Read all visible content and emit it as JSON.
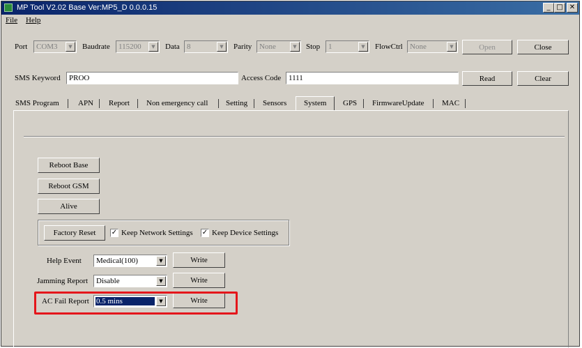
{
  "window": {
    "title": "MP Tool V2.02  Base Ver:MP5_D 0.0.0.15",
    "controls": {
      "minimize": "_",
      "maximize": "□",
      "close": "✕"
    }
  },
  "menu": {
    "file": "File",
    "help": "Help"
  },
  "connection": {
    "port_label": "Port",
    "port_value": "COM3",
    "baudrate_label": "Baudrate",
    "baudrate_value": "115200",
    "data_label": "Data",
    "data_value": "8",
    "parity_label": "Parity",
    "parity_value": "None",
    "stop_label": "Stop",
    "stop_value": "1",
    "flowctrl_label": "FlowCtrl",
    "flowctrl_value": "None",
    "open_label": "Open",
    "close_label": "Close"
  },
  "sms": {
    "keyword_label": "SMS Keyword",
    "keyword_value": "PROO",
    "access_label": "Access Code",
    "access_value": "1111",
    "read_label": "Read",
    "clear_label": "Clear"
  },
  "tabs": [
    "SMS Program",
    "APN",
    "Report",
    "Non emergency call",
    "Setting",
    "Sensors",
    "System",
    "GPS",
    "FirmwareUpdate",
    "MAC"
  ],
  "active_tab": "System",
  "system": {
    "reboot_base": "Reboot Base",
    "reboot_gsm": "Reboot GSM",
    "alive": "Alive",
    "factory_reset": "Factory Reset",
    "keep_network": "Keep Network Settings",
    "keep_device": "Keep Device Settings",
    "check_mark": "✓",
    "help_event_label": "Help Event",
    "help_event_value": "Medical(100)",
    "jamming_label": "Jamming Report",
    "jamming_value": "Disable",
    "ac_fail_label": "AC Fail Report",
    "ac_fail_value": "0.5 mins",
    "write_label": "Write",
    "dropdown_arrow": "▼"
  },
  "colors": {
    "highlight": "#e4161b",
    "titlebar": "#0a246a",
    "face": "#d4d0c8"
  }
}
